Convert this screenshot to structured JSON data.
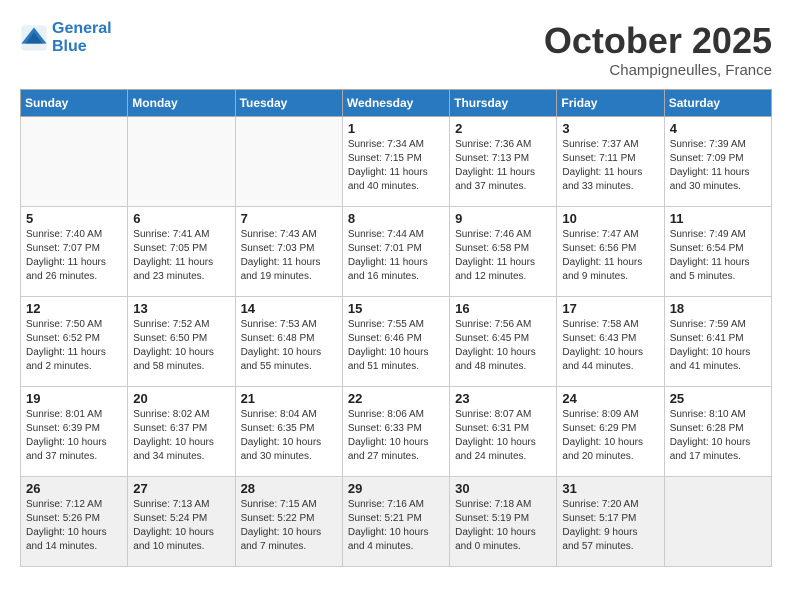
{
  "header": {
    "logo_line1": "General",
    "logo_line2": "Blue",
    "month": "October 2025",
    "location": "Champigneulles, France"
  },
  "days_of_week": [
    "Sunday",
    "Monday",
    "Tuesday",
    "Wednesday",
    "Thursday",
    "Friday",
    "Saturday"
  ],
  "weeks": [
    [
      {
        "day": "",
        "detail": ""
      },
      {
        "day": "",
        "detail": ""
      },
      {
        "day": "",
        "detail": ""
      },
      {
        "day": "1",
        "detail": "Sunrise: 7:34 AM\nSunset: 7:15 PM\nDaylight: 11 hours\nand 40 minutes."
      },
      {
        "day": "2",
        "detail": "Sunrise: 7:36 AM\nSunset: 7:13 PM\nDaylight: 11 hours\nand 37 minutes."
      },
      {
        "day": "3",
        "detail": "Sunrise: 7:37 AM\nSunset: 7:11 PM\nDaylight: 11 hours\nand 33 minutes."
      },
      {
        "day": "4",
        "detail": "Sunrise: 7:39 AM\nSunset: 7:09 PM\nDaylight: 11 hours\nand 30 minutes."
      }
    ],
    [
      {
        "day": "5",
        "detail": "Sunrise: 7:40 AM\nSunset: 7:07 PM\nDaylight: 11 hours\nand 26 minutes."
      },
      {
        "day": "6",
        "detail": "Sunrise: 7:41 AM\nSunset: 7:05 PM\nDaylight: 11 hours\nand 23 minutes."
      },
      {
        "day": "7",
        "detail": "Sunrise: 7:43 AM\nSunset: 7:03 PM\nDaylight: 11 hours\nand 19 minutes."
      },
      {
        "day": "8",
        "detail": "Sunrise: 7:44 AM\nSunset: 7:01 PM\nDaylight: 11 hours\nand 16 minutes."
      },
      {
        "day": "9",
        "detail": "Sunrise: 7:46 AM\nSunset: 6:58 PM\nDaylight: 11 hours\nand 12 minutes."
      },
      {
        "day": "10",
        "detail": "Sunrise: 7:47 AM\nSunset: 6:56 PM\nDaylight: 11 hours\nand 9 minutes."
      },
      {
        "day": "11",
        "detail": "Sunrise: 7:49 AM\nSunset: 6:54 PM\nDaylight: 11 hours\nand 5 minutes."
      }
    ],
    [
      {
        "day": "12",
        "detail": "Sunrise: 7:50 AM\nSunset: 6:52 PM\nDaylight: 11 hours\nand 2 minutes."
      },
      {
        "day": "13",
        "detail": "Sunrise: 7:52 AM\nSunset: 6:50 PM\nDaylight: 10 hours\nand 58 minutes."
      },
      {
        "day": "14",
        "detail": "Sunrise: 7:53 AM\nSunset: 6:48 PM\nDaylight: 10 hours\nand 55 minutes."
      },
      {
        "day": "15",
        "detail": "Sunrise: 7:55 AM\nSunset: 6:46 PM\nDaylight: 10 hours\nand 51 minutes."
      },
      {
        "day": "16",
        "detail": "Sunrise: 7:56 AM\nSunset: 6:45 PM\nDaylight: 10 hours\nand 48 minutes."
      },
      {
        "day": "17",
        "detail": "Sunrise: 7:58 AM\nSunset: 6:43 PM\nDaylight: 10 hours\nand 44 minutes."
      },
      {
        "day": "18",
        "detail": "Sunrise: 7:59 AM\nSunset: 6:41 PM\nDaylight: 10 hours\nand 41 minutes."
      }
    ],
    [
      {
        "day": "19",
        "detail": "Sunrise: 8:01 AM\nSunset: 6:39 PM\nDaylight: 10 hours\nand 37 minutes."
      },
      {
        "day": "20",
        "detail": "Sunrise: 8:02 AM\nSunset: 6:37 PM\nDaylight: 10 hours\nand 34 minutes."
      },
      {
        "day": "21",
        "detail": "Sunrise: 8:04 AM\nSunset: 6:35 PM\nDaylight: 10 hours\nand 30 minutes."
      },
      {
        "day": "22",
        "detail": "Sunrise: 8:06 AM\nSunset: 6:33 PM\nDaylight: 10 hours\nand 27 minutes."
      },
      {
        "day": "23",
        "detail": "Sunrise: 8:07 AM\nSunset: 6:31 PM\nDaylight: 10 hours\nand 24 minutes."
      },
      {
        "day": "24",
        "detail": "Sunrise: 8:09 AM\nSunset: 6:29 PM\nDaylight: 10 hours\nand 20 minutes."
      },
      {
        "day": "25",
        "detail": "Sunrise: 8:10 AM\nSunset: 6:28 PM\nDaylight: 10 hours\nand 17 minutes."
      }
    ],
    [
      {
        "day": "26",
        "detail": "Sunrise: 7:12 AM\nSunset: 5:26 PM\nDaylight: 10 hours\nand 14 minutes."
      },
      {
        "day": "27",
        "detail": "Sunrise: 7:13 AM\nSunset: 5:24 PM\nDaylight: 10 hours\nand 10 minutes."
      },
      {
        "day": "28",
        "detail": "Sunrise: 7:15 AM\nSunset: 5:22 PM\nDaylight: 10 hours\nand 7 minutes."
      },
      {
        "day": "29",
        "detail": "Sunrise: 7:16 AM\nSunset: 5:21 PM\nDaylight: 10 hours\nand 4 minutes."
      },
      {
        "day": "30",
        "detail": "Sunrise: 7:18 AM\nSunset: 5:19 PM\nDaylight: 10 hours\nand 0 minutes."
      },
      {
        "day": "31",
        "detail": "Sunrise: 7:20 AM\nSunset: 5:17 PM\nDaylight: 9 hours\nand 57 minutes."
      },
      {
        "day": "",
        "detail": ""
      }
    ]
  ]
}
